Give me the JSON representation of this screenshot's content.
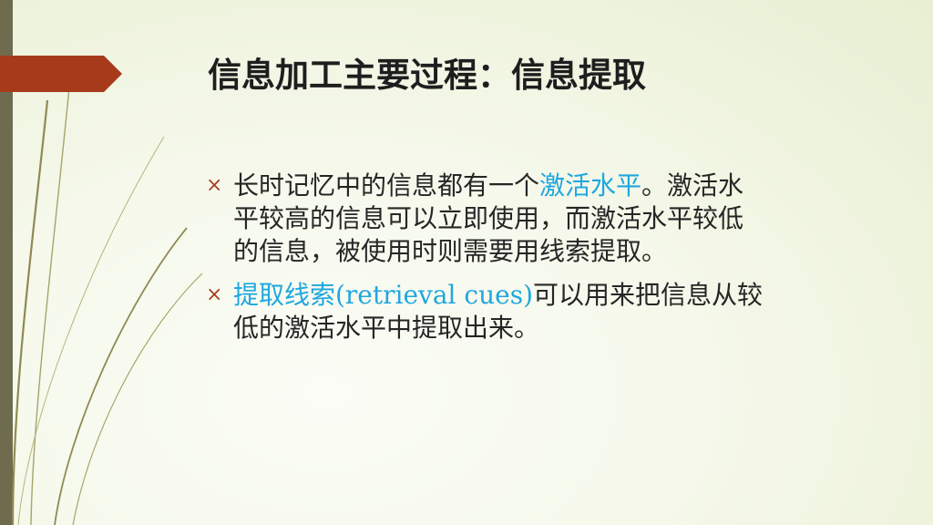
{
  "slide": {
    "title": "信息加工主要过程：信息提取",
    "bullet_marker": "×",
    "bullets": [
      {
        "lines": [
          [
            {
              "text": "长时记忆中的信息都有一个",
              "highlight": false
            },
            {
              "text": "激活水平",
              "highlight": true
            },
            {
              "text": "。激活水",
              "highlight": false
            }
          ],
          [
            {
              "text": "平较高的信息可以立即使用，而激活水平较低",
              "highlight": false
            }
          ],
          [
            {
              "text": "的信息，被使用时则需要用线索提取。",
              "highlight": false
            }
          ]
        ]
      },
      {
        "lines": [
          [
            {
              "text": "提取线索(retrieval cues)",
              "highlight": true
            },
            {
              "text": "可以用来把信息从较",
              "highlight": false
            }
          ],
          [
            {
              "text": "低的激活水平中提取出来。",
              "highlight": false
            }
          ]
        ]
      }
    ]
  },
  "colors": {
    "accent_red": "#a83a1c",
    "highlight_blue": "#1fa7e0",
    "left_bar": "#6e6b4f",
    "deco_line": "#8f8a55"
  }
}
